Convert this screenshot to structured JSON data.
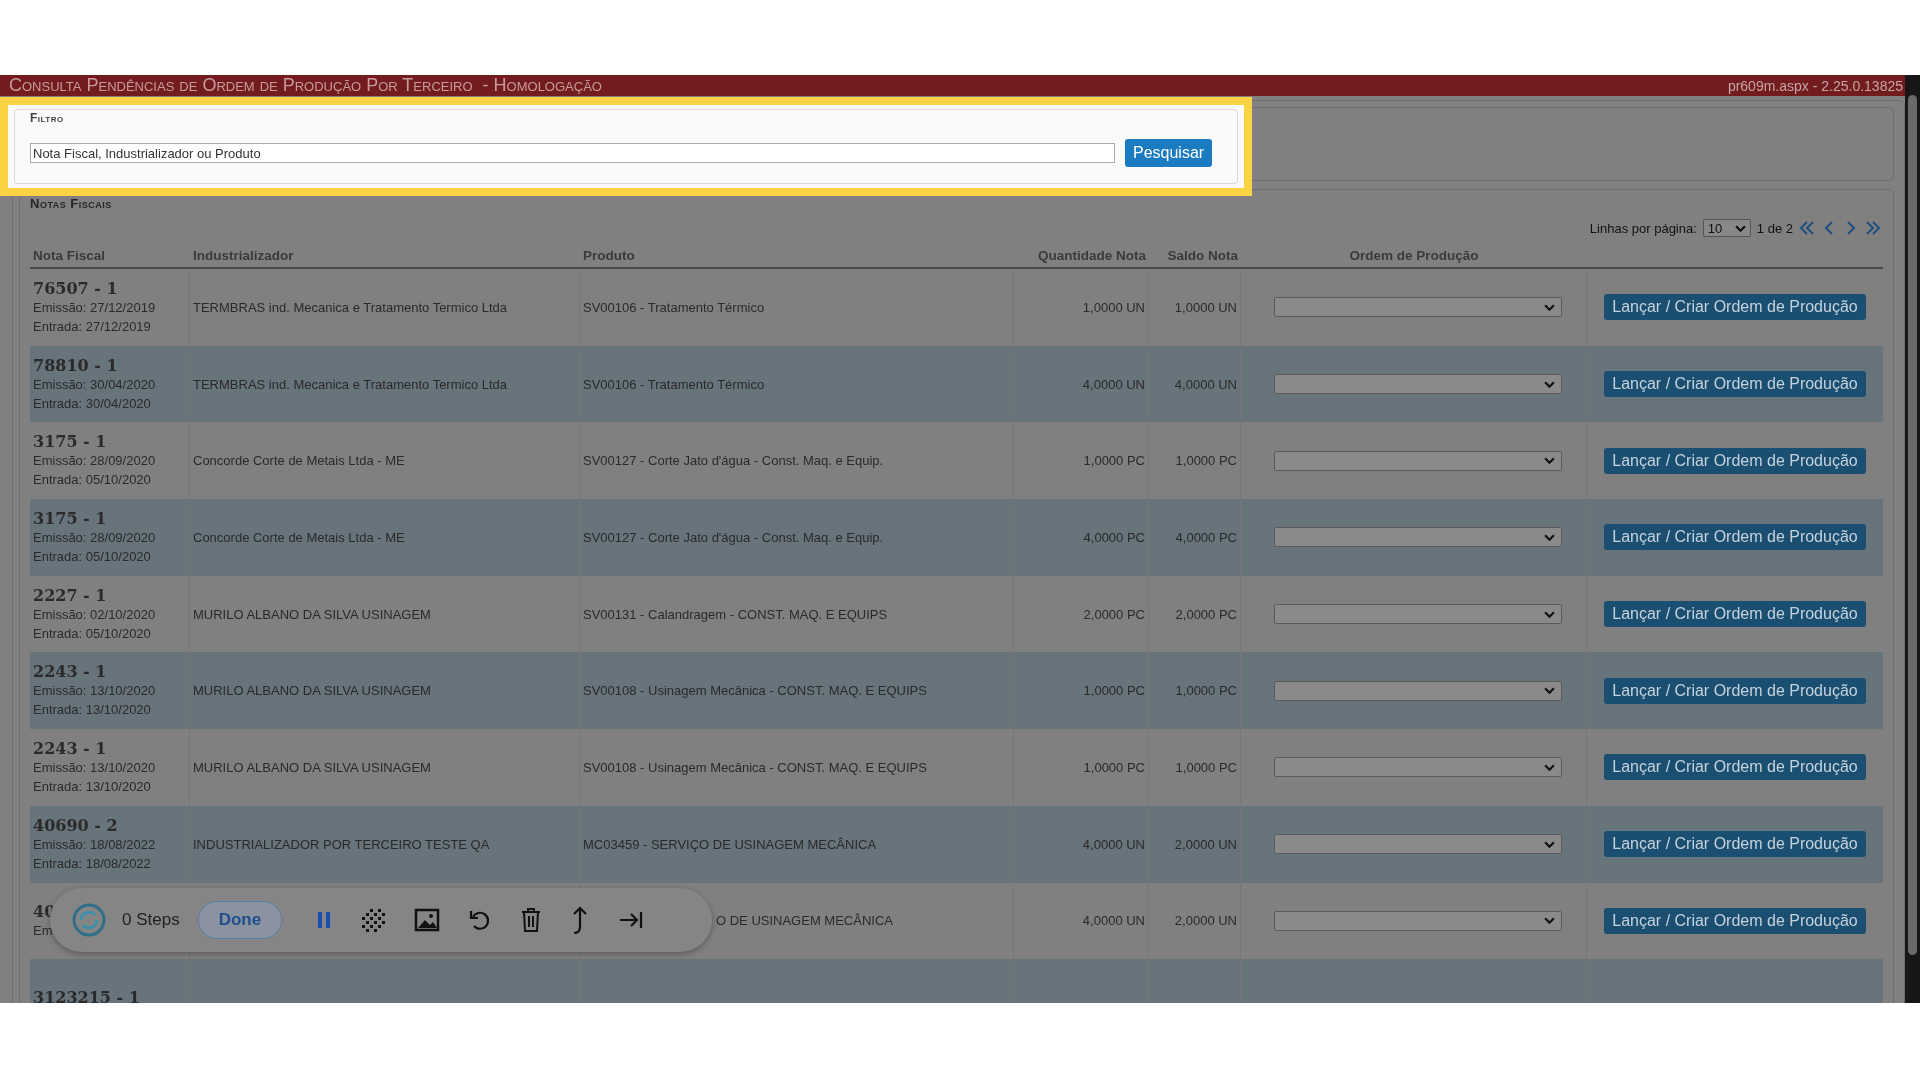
{
  "window": {
    "title": "Consulta Pendências de Ordem de Produção Por Terceiro  - Homologação",
    "version": "pr609m.aspx - 2.25.0.13825"
  },
  "filter": {
    "legend": "Filtro",
    "search": {
      "placeholder": "Nota Fiscal, Industrializador ou Produto"
    },
    "button": "Pesquisar"
  },
  "notas_fiscais": {
    "legend": "Notas Fiscais",
    "pagination": {
      "label": "Linhas por página:",
      "rows_per_page": "10",
      "page": "1 de 2"
    },
    "columns": [
      "Nota Fiscal",
      "Industrializador",
      "Produto",
      "Quantidade Nota",
      "Saldo Nota",
      "Ordem de Produção"
    ],
    "rows": [
      {
        "nota": "76507 - 1",
        "emissao": "Emissão: 27/12/2019",
        "entrada": "Entrada: 27/12/2019",
        "industrializador": "TERMBRAS ind. Mecanica e Tratamento Termico Ltda",
        "produto": "SV00106 - Tratamento Térmico",
        "quantidade": "1,0000 UN",
        "saldo": "1,0000 UN",
        "action": "Lançar / Criar Ordem de Produção"
      },
      {
        "nota": "78810 - 1",
        "emissao": "Emissão: 30/04/2020",
        "entrada": "Entrada: 30/04/2020",
        "industrializador": "TERMBRAS ind. Mecanica e Tratamento Termico Ltda",
        "produto": "SV00106 - Tratamento Térmico",
        "quantidade": "4,0000 UN",
        "saldo": "4,0000 UN",
        "action": "Lançar / Criar Ordem de Produção"
      },
      {
        "nota": "3175 - 1",
        "emissao": "Emissão: 28/09/2020",
        "entrada": "Entrada: 05/10/2020",
        "industrializador": "Concorde Corte de Metais Ltda - ME",
        "produto": "SV00127 - Corte Jato d'água - Const. Maq. e Equip.",
        "quantidade": "1,0000 PC",
        "saldo": "1,0000 PC",
        "action": "Lançar / Criar Ordem de Produção"
      },
      {
        "nota": "3175 - 1",
        "emissao": "Emissão: 28/09/2020",
        "entrada": "Entrada: 05/10/2020",
        "industrializador": "Concorde Corte de Metais Ltda - ME",
        "produto": "SV00127 - Corte Jato d'água - Const. Maq. e Equip.",
        "quantidade": "4,0000 PC",
        "saldo": "4,0000 PC",
        "action": "Lançar / Criar Ordem de Produção"
      },
      {
        "nota": "2227 - 1",
        "emissao": "Emissão: 02/10/2020",
        "entrada": "Entrada: 05/10/2020",
        "industrializador": "MURILO ALBANO DA SILVA USINAGEM",
        "produto": "SV00131 - Calandragem - CONST. MAQ. E EQUIPS",
        "quantidade": "2,0000 PC",
        "saldo": "2,0000 PC",
        "action": "Lançar / Criar Ordem de Produção"
      },
      {
        "nota": "2243 - 1",
        "emissao": "Emissão: 13/10/2020",
        "entrada": "Entrada: 13/10/2020",
        "industrializador": "MURILO ALBANO DA SILVA USINAGEM",
        "produto": "SV00108 - Usinagem Mecânica - CONST. MAQ. E EQUIPS",
        "quantidade": "1,0000 PC",
        "saldo": "1,0000 PC",
        "action": "Lançar / Criar Ordem de Produção"
      },
      {
        "nota": "2243 - 1",
        "emissao": "Emissão: 13/10/2020",
        "entrada": "Entrada: 13/10/2020",
        "industrializador": "MURILO ALBANO DA SILVA USINAGEM",
        "produto": "SV00108 - Usinagem Mecânica - CONST. MAQ. E EQUIPS",
        "quantidade": "1,0000 PC",
        "saldo": "1,0000 PC",
        "action": "Lançar / Criar Ordem de Produção"
      },
      {
        "nota": "40690 - 2",
        "emissao": "Emissão: 18/08/2022",
        "entrada": "Entrada: 18/08/2022",
        "industrializador": "INDUSTRIALIZADOR POR TERCEIRO TESTE QA",
        "produto": "MC03459 - SERVIÇO DE USINAGEM MECÂNICA",
        "quantidade": "4,0000 UN",
        "saldo": "2,0000 UN",
        "action": "Lançar / Criar Ordem de Produção"
      },
      {
        "nota": "40",
        "emissao": "Em",
        "produto": "O DE USINAGEM MECÂNICA",
        "quantidade": "4,0000 UN",
        "saldo": "2,0000 UN",
        "action": "Lançar / Criar Ordem de Produção",
        "covered": true
      },
      {
        "nota": "3123215 - 1"
      }
    ]
  },
  "recorder": {
    "steps": "0 Steps",
    "done": "Done"
  }
}
